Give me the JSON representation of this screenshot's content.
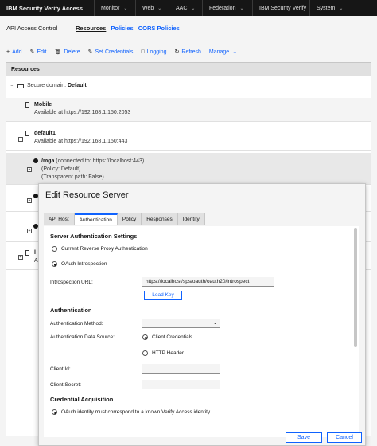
{
  "app": {
    "brand": "IBM Security Verify Access",
    "nav": [
      {
        "label": "Monitor"
      },
      {
        "label": "Web"
      },
      {
        "label": "AAC"
      },
      {
        "label": "Federation"
      },
      {
        "label": "IBM Security Verify"
      },
      {
        "label": "System"
      }
    ]
  },
  "page": {
    "title": "API Access Control",
    "links": {
      "resources": "Resources",
      "policies": "Policies",
      "cors": "CORS Policies"
    }
  },
  "toolbar": {
    "add": "Add",
    "edit": "Edit",
    "delete": "Delete",
    "set_credentials": "Set Credentials",
    "logging": "Logging",
    "refresh": "Refresh",
    "manage": "Manage"
  },
  "table": {
    "header": "Resources",
    "domain_prefix": "Secure domain:",
    "domain_name": "Default",
    "rows": [
      {
        "name": "Mobile",
        "detail": "Available at https://192.168.1.150:2053"
      },
      {
        "name": "default1",
        "detail": "Available at https://192.168.1.150:443"
      },
      {
        "path": "/mga",
        "connected": "(connected to: https://localhost:443)",
        "policy": "(Policy: Default)",
        "transparent": "(Transparent path: False)"
      },
      {
        "partial": "l",
        "partial2": "A"
      }
    ]
  },
  "modal": {
    "title": "Edit Resource Server",
    "tabs": [
      "API Host",
      "Authentication",
      "Policy",
      "Responses",
      "Identity"
    ],
    "server_auth_title": "Server Authentication Settings",
    "opt_reverse_proxy": "Current Reverse Proxy Authentication",
    "opt_oauth": "OAuth Introspection",
    "introspection_label": "Introspection URL:",
    "introspection_value": "https://localhost/sps/oauth/oauth20/introspect",
    "load_key": "Load Key",
    "auth_title": "Authentication",
    "auth_method_label": "Authentication Method:",
    "auth_source_label": "Authentication Data Source:",
    "opt_client_credentials": "Client Credentials",
    "opt_http_header": "HTTP Header",
    "client_id_label": "Client Id:",
    "client_secret_label": "Client Secret:",
    "cred_title": "Credential Acquisition",
    "opt_cred": "OAuth identity must correspond to a known Verify Access identity",
    "save": "Save",
    "cancel": "Cancel"
  }
}
